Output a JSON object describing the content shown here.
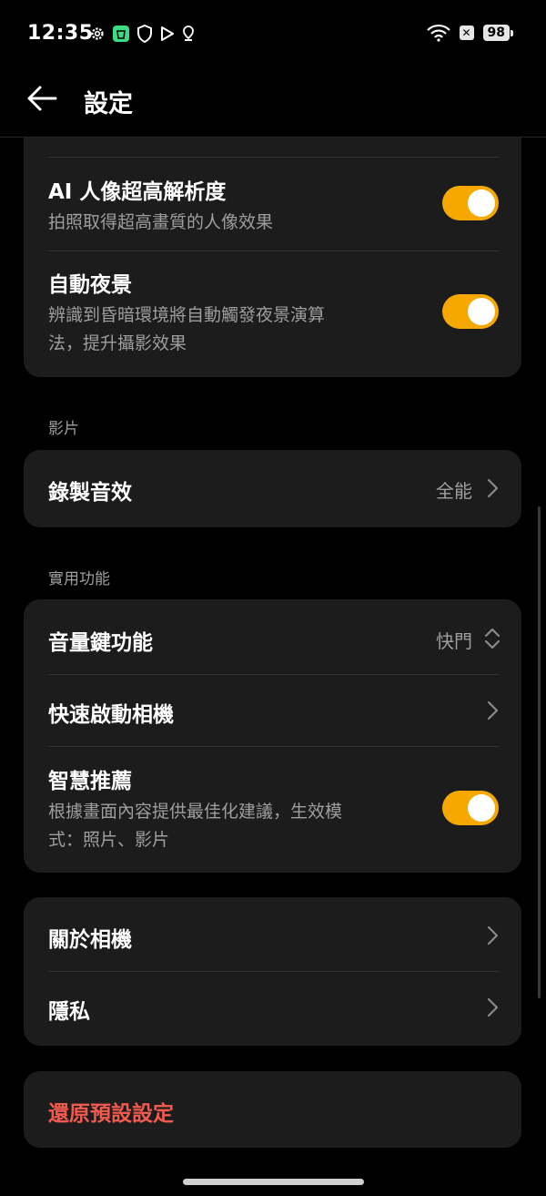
{
  "status_bar": {
    "time": "12:35",
    "battery": "98",
    "icons": [
      "gear-icon",
      "shopping-app-icon",
      "shield-icon",
      "play-icon",
      "location-pin-icon",
      "wifi-icon",
      "no-sim-icon",
      "battery-icon"
    ]
  },
  "app_bar": {
    "title": "設定"
  },
  "photo_group": {
    "items": [
      {
        "title": "AI 人像超高解析度",
        "subtitle": "拍照取得超高畫質的人像效果",
        "toggle_on": true
      },
      {
        "title": "自動夜景",
        "subtitle_line1": "辨識到昏暗環境將自動觸發夜景演算",
        "subtitle_line2": "法，提升攝影效果",
        "toggle_on": true
      }
    ]
  },
  "video_section": {
    "label": "影片",
    "items": [
      {
        "title": "錄製音效",
        "value": "全能"
      }
    ]
  },
  "utility_section": {
    "label": "實用功能",
    "items": [
      {
        "title": "音量鍵功能",
        "value": "快門"
      },
      {
        "title": "快速啟動相機"
      },
      {
        "title": "智慧推薦",
        "subtitle_line1": "根據畫面內容提供最佳化建議，生效模",
        "subtitle_line2": "式：照片、影片",
        "toggle_on": true
      }
    ]
  },
  "about_group": {
    "items": [
      {
        "title": "關於相機"
      },
      {
        "title": "隱私"
      }
    ]
  },
  "reset": {
    "label": "還原預設設定"
  },
  "colors": {
    "accent": "#f5a800",
    "danger": "#f05a4f",
    "card": "#1c1c1c",
    "background": "#000000"
  }
}
